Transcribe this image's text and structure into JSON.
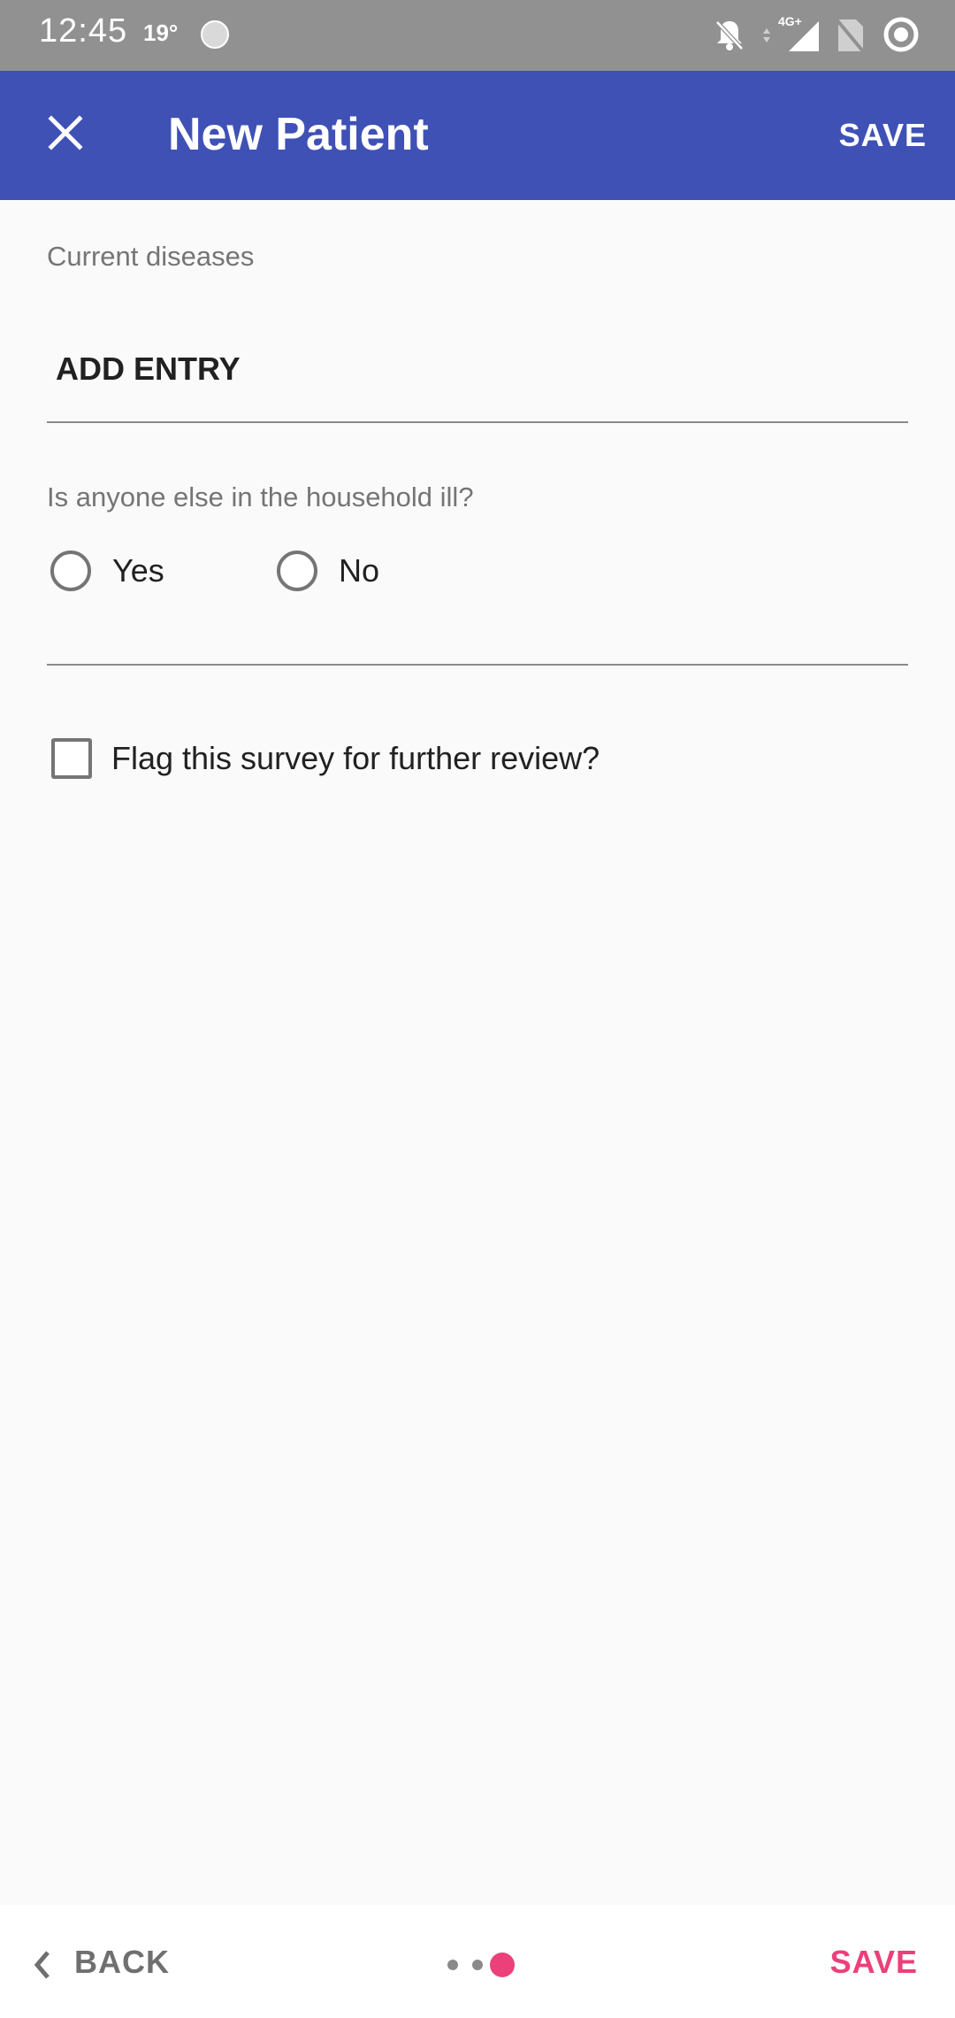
{
  "status_bar": {
    "time": "12:45",
    "temperature": "19°",
    "icons": [
      "weather-icon",
      "notifications-off-icon",
      "network-4g-icon",
      "signal-icon",
      "no-sim-icon",
      "record-icon"
    ],
    "network_label": "4G+"
  },
  "app_bar": {
    "title": "New Patient",
    "save_label": "SAVE",
    "close_icon": "close-icon",
    "background": "#3f51b5"
  },
  "form": {
    "current_diseases_label": "Current diseases",
    "add_entry_label": "ADD ENTRY",
    "household_question": "Is anyone else in the household ill?",
    "household_options": [
      "Yes",
      "No"
    ],
    "household_selected": null,
    "flag_label": "Flag this survey for further review?",
    "flag_checked": false
  },
  "bottom_bar": {
    "back_label": "BACK",
    "save_label": "SAVE",
    "page_count": 3,
    "current_page": 3,
    "accent": "#ec407a"
  }
}
